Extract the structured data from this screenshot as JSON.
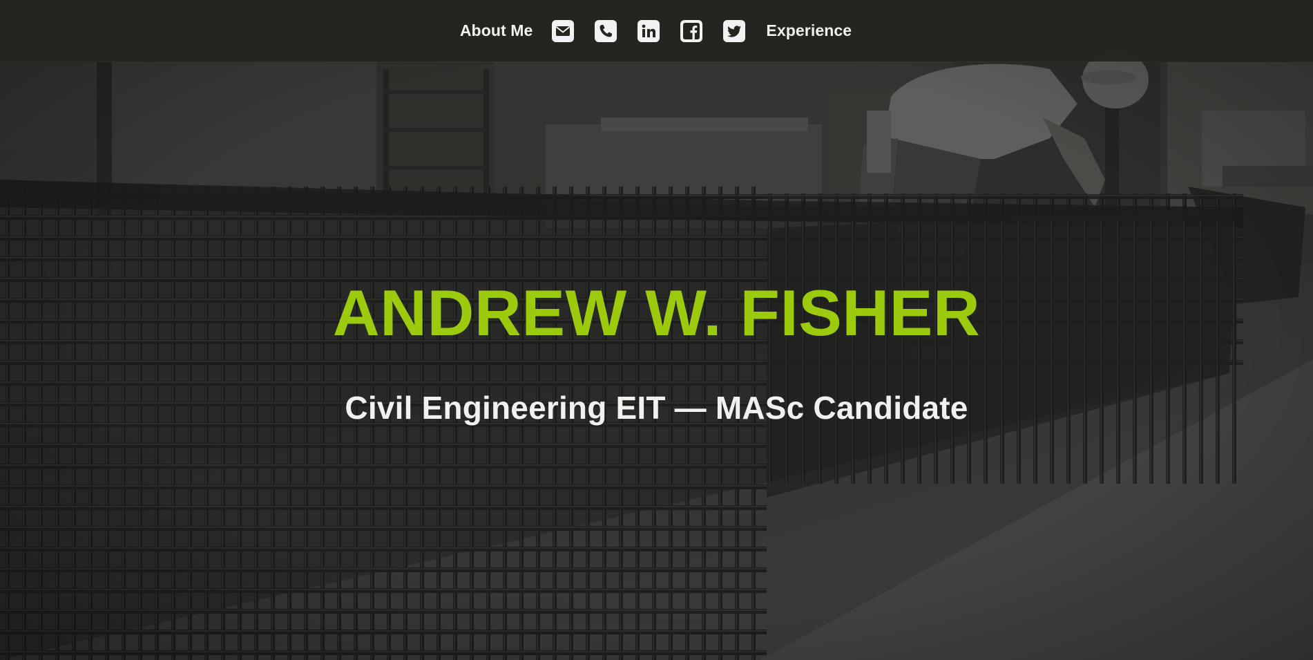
{
  "nav": {
    "about_label": "About Me",
    "experience_label": "Experience",
    "social": [
      {
        "icon": "envelope-icon",
        "label": "Email"
      },
      {
        "icon": "phone-icon",
        "label": "Phone"
      },
      {
        "icon": "linkedin-icon",
        "label": "LinkedIn"
      },
      {
        "icon": "facebook-icon",
        "label": "Facebook"
      },
      {
        "icon": "twitter-icon",
        "label": "Twitter"
      }
    ]
  },
  "hero": {
    "name": "ANDREW W. FISHER",
    "subtitle": "Civil Engineering EIT — MASc Candidate",
    "background_image": "grayscale-photo-rebar-cages-worker-hardhat"
  },
  "colors": {
    "accent": "#9bcb0c",
    "navbar": "#26241f",
    "text_light": "#f1f1ee",
    "icon_bg": "#f2f2f2"
  }
}
